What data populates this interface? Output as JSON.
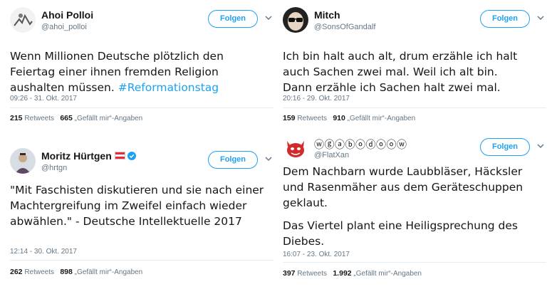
{
  "tweets": [
    {
      "name": "Ahoi Polloi",
      "handle": "@ahoi_polloi",
      "follow_label": "Folgen",
      "text": "Wenn Millionen Deutsche plötzlich den Feiertag einer ihnen fremden Religion aushalten müssen.",
      "hashtag": "#Reformationstag",
      "timestamp": "09:26 - 31. Okt. 2017",
      "retweets": "215",
      "retweets_label": "Retweets",
      "likes": "665",
      "likes_label": "„Gefällt mir“-Angaben"
    },
    {
      "name": "Mitch",
      "handle": "@SonsOfGandalf",
      "follow_label": "Folgen",
      "text": "Ich bin halt auch alt, drum erzähle ich halt auch Sachen zwei mal. Weil ich alt bin. Dann erzähle ich Sachen halt zwei mal.",
      "timestamp": "20:16 - 29. Okt. 2017",
      "retweets": "159",
      "retweets_label": "Retweets",
      "likes": "910",
      "likes_label": "„Gefällt mir“-Angaben"
    },
    {
      "name": "Moritz Hürtgen",
      "handle": "@hrtgn",
      "follow_label": "Folgen",
      "text": "\"Mit Faschisten diskutieren und sie nach einer Machtergreifung im Zweifel einfach wieder abwählen.\" - Deutsche Intellektuelle 2017",
      "timestamp": "12:14 - 30. Okt. 2017",
      "retweets": "262",
      "retweets_label": "Retweets",
      "likes": "898",
      "likes_label": "„Gefällt mir“-Angaben"
    },
    {
      "name": "ⓦⓖⓐⓑⓞⓓⓞⓞⓦ",
      "handle": "@FlatXan",
      "follow_label": "Folgen",
      "text": "Dem Nachbarn wurde Laubbläser, Häcksler und Rasenmäher aus dem Geräteschuppen geklaut.",
      "text2": "Das Viertel plant eine Heiligsprechung des Diebes.",
      "timestamp": "16:07 - 23. Okt. 2017",
      "retweets": "397",
      "retweets_label": "Retweets",
      "likes": "1.992",
      "likes_label": "„Gefällt mir“-Angaben"
    }
  ],
  "icons": {
    "chevron": "chevron-down-icon",
    "verified": "verified-badge-icon",
    "flag": "austria-flag-icon"
  },
  "colors": {
    "accent": "#1da1f2",
    "secondary_text": "#657786",
    "divider": "#e6ecf0"
  }
}
